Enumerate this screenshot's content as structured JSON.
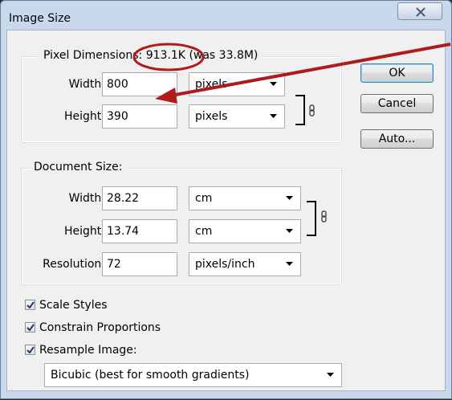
{
  "window": {
    "title": "Image Size"
  },
  "pixel_dimensions": {
    "legend_label": "Pixel Dimensions:",
    "size": "913.1K",
    "was": "(was 33.8M)",
    "width_label": "Width:",
    "width_value": "800",
    "width_unit": "pixels",
    "height_label": "Height:",
    "height_value": "390",
    "height_unit": "pixels"
  },
  "document_size": {
    "legend_label": "Document Size:",
    "width_label": "Width:",
    "width_value": "28.22",
    "width_unit": "cm",
    "height_label": "Height:",
    "height_value": "13.74",
    "height_unit": "cm",
    "resolution_label": "Resolution:",
    "resolution_value": "72",
    "resolution_unit": "pixels/inch"
  },
  "buttons": {
    "ok": "OK",
    "cancel": "Cancel",
    "auto": "Auto..."
  },
  "options": {
    "scale_styles": {
      "label": "Scale Styles",
      "checked": true
    },
    "constrain_proportions": {
      "label": "Constrain Proportions",
      "checked": true
    },
    "resample_image": {
      "label": "Resample Image:",
      "checked": true
    }
  },
  "resample_method": "Bicubic (best for smooth gradients)",
  "annotation": {
    "color": "#b11a1a"
  }
}
